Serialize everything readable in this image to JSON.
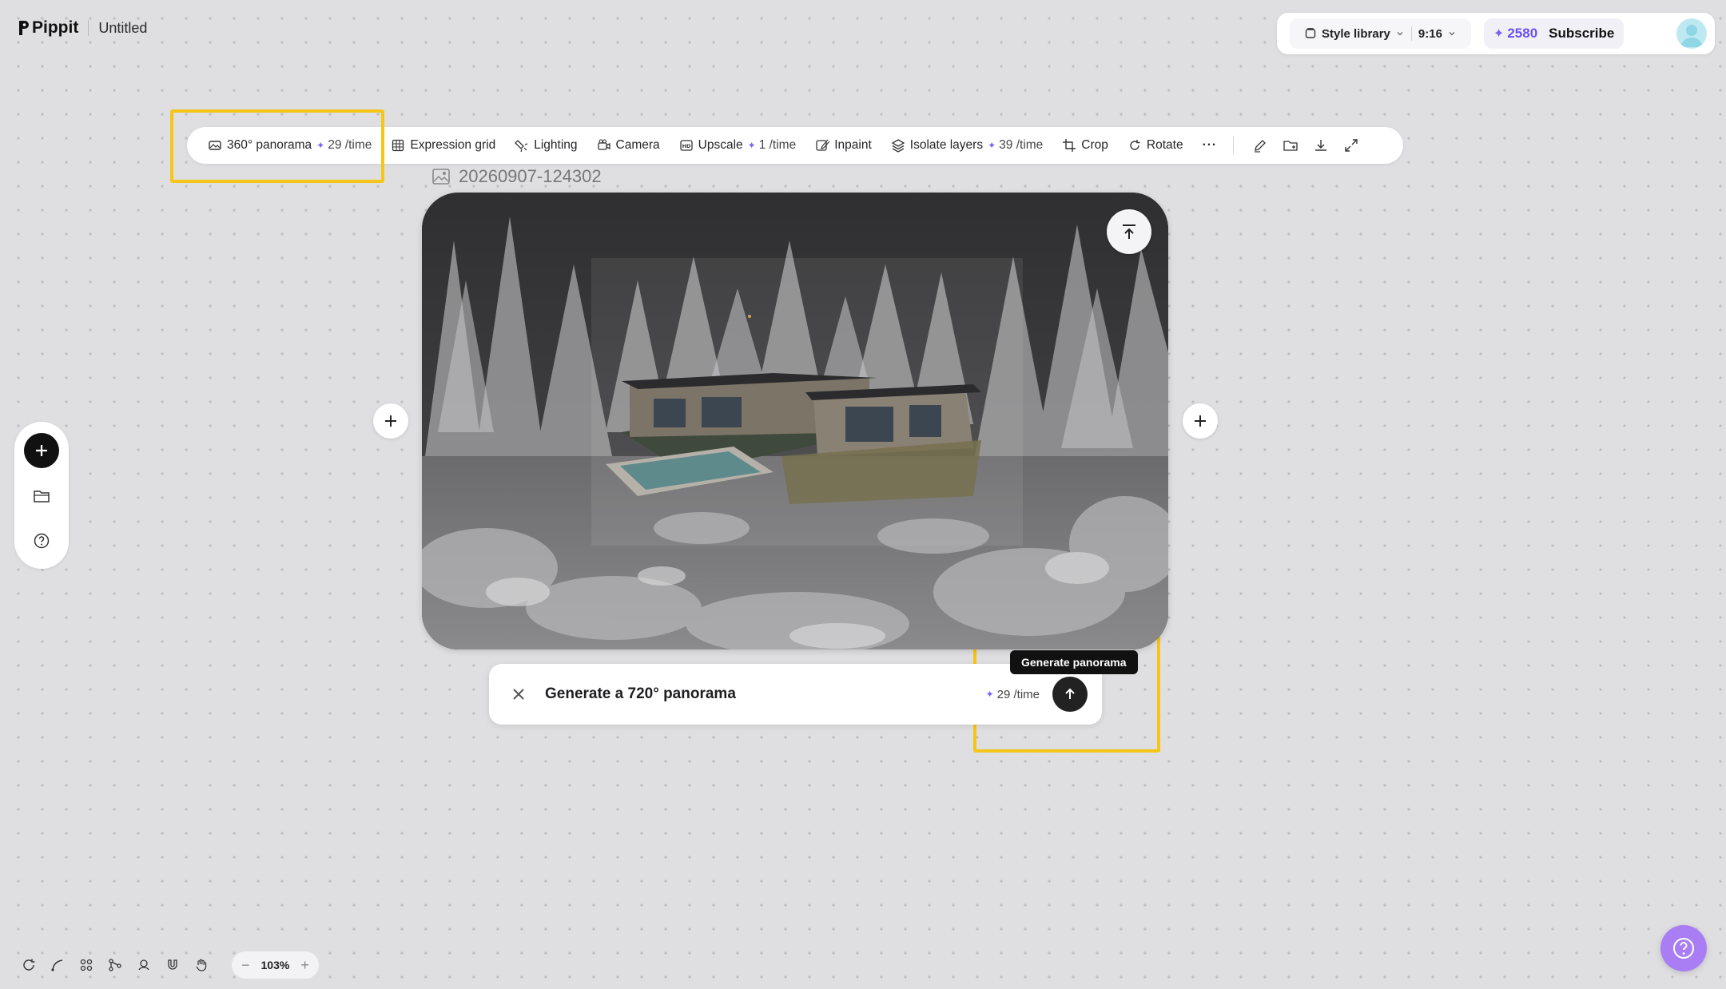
{
  "header": {
    "brand": "Pippit",
    "doc_title": "Untitled"
  },
  "top_right": {
    "style_library": "Style library",
    "aspect_ratio": "9:16",
    "credits": "2580",
    "subscribe": "Subscribe"
  },
  "toolbar": {
    "items": [
      {
        "label": "360° panorama",
        "cost": "29 /time"
      },
      {
        "label": "Expression grid"
      },
      {
        "label": "Lighting"
      },
      {
        "label": "Camera"
      },
      {
        "label": "Upscale",
        "cost": "1 /time"
      },
      {
        "label": "Inpaint"
      },
      {
        "label": "Isolate layers",
        "cost": "39 /time"
      },
      {
        "label": "Crop"
      },
      {
        "label": "Rotate"
      }
    ],
    "more": "···"
  },
  "canvas": {
    "image_name": "20260907-124302"
  },
  "prompt": {
    "text": "Generate a 720° panorama",
    "cost": "29 /time",
    "tooltip": "Generate panorama"
  },
  "bottom": {
    "zoom_level": "103%",
    "zoom_minus": "−",
    "zoom_plus": "+"
  },
  "colors": {
    "accent": "#7b63f6",
    "highlight": "#f5c518",
    "help": "#a97ef4"
  }
}
